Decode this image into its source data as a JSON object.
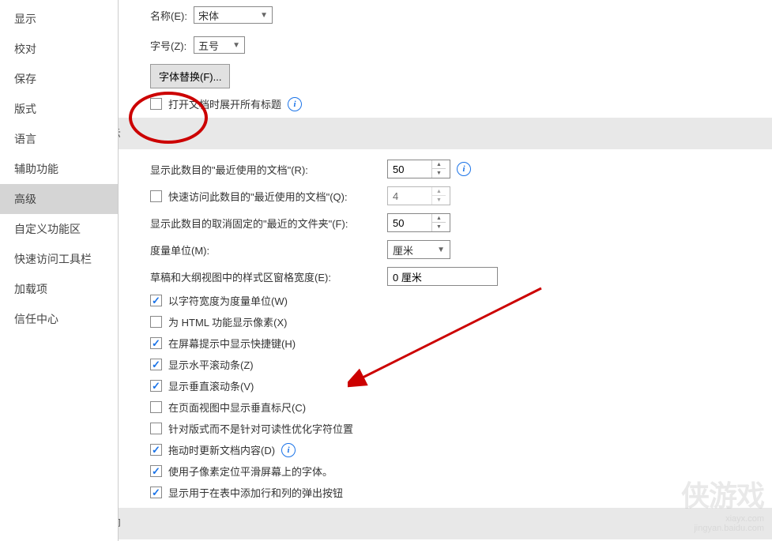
{
  "sidebar": {
    "items": [
      {
        "label": "显示"
      },
      {
        "label": "校对"
      },
      {
        "label": "保存"
      },
      {
        "label": "版式"
      },
      {
        "label": "语言"
      },
      {
        "label": "辅助功能"
      },
      {
        "label": "高级"
      },
      {
        "label": "自定义功能区"
      },
      {
        "label": "快速访问工具栏"
      },
      {
        "label": "加载项"
      },
      {
        "label": "信任中心"
      }
    ]
  },
  "font_section": {
    "name_label": "名称(E):",
    "name_value": "宋体",
    "size_label": "字号(Z):",
    "size_value": "五号",
    "replace_button": "字体替换(F)...",
    "expand_checkbox": "打开文档时展开所有标题"
  },
  "display_section": {
    "header": "显示",
    "recent_docs_label": "显示此数目的\"最近使用的文档\"(R):",
    "recent_docs_value": "50",
    "quick_access_label": "快速访问此数目的\"最近使用的文档\"(Q):",
    "quick_access_value": "4",
    "unpinned_label": "显示此数目的取消固定的\"最近的文件夹\"(F):",
    "unpinned_value": "50",
    "unit_label": "度量单位(M):",
    "unit_value": "厘米",
    "style_width_label": "草稿和大纲视图中的样式区窗格宽度(E):",
    "style_width_value": "0 厘米",
    "checkboxes": [
      {
        "checked": true,
        "label": "以字符宽度为度量单位(W)"
      },
      {
        "checked": false,
        "label": "为 HTML 功能显示像素(X)"
      },
      {
        "checked": true,
        "label": "在屏幕提示中显示快捷键(H)"
      },
      {
        "checked": true,
        "label": "显示水平滚动条(Z)"
      },
      {
        "checked": true,
        "label": "显示垂直滚动条(V)"
      },
      {
        "checked": false,
        "label": "在页面视图中显示垂直标尺(C)"
      },
      {
        "checked": false,
        "label": "针对版式而不是针对可读性优化字符位置"
      },
      {
        "checked": true,
        "label": "拖动时更新文档内容(D)"
      },
      {
        "checked": true,
        "label": "使用子像素定位平滑屏幕上的字体。"
      },
      {
        "checked": true,
        "label": "显示用于在表中添加行和列的弹出按钮"
      }
    ]
  },
  "print_section": {
    "header": "打印"
  },
  "watermark": {
    "logo": "侠游戏",
    "url": "xiayx.com",
    "sub": "jingyan.baidu.com"
  }
}
